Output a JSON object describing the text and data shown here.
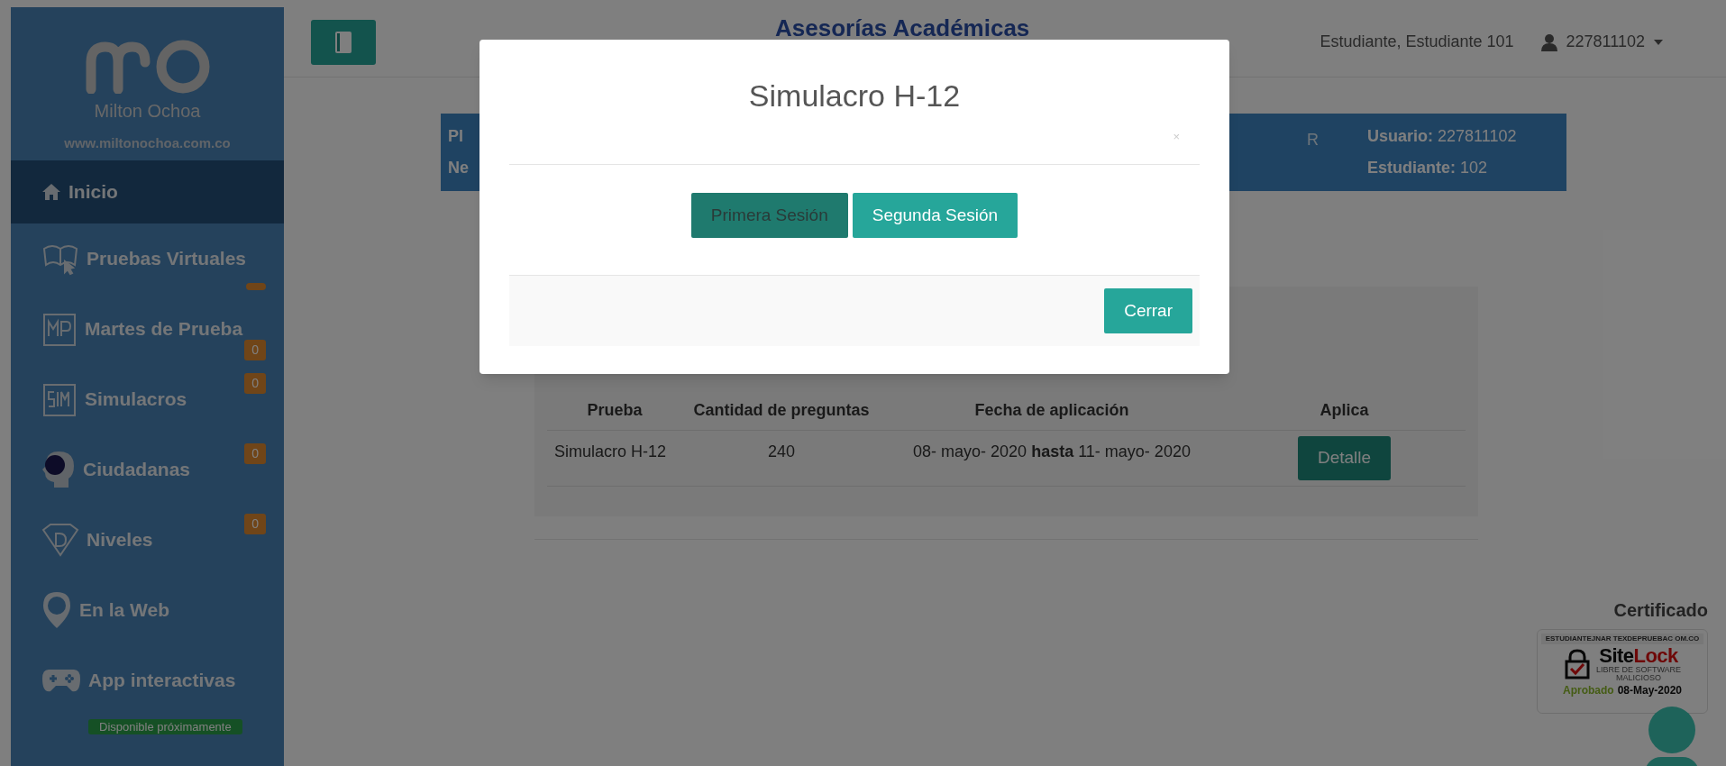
{
  "sidebar": {
    "brand": "Milton Ochoa",
    "website": "www.miltonochoa.com.co",
    "items": [
      {
        "label": "Inicio",
        "selected": true
      },
      {
        "label": "Pruebas Virtuales",
        "selected": false,
        "empty_badge": true
      },
      {
        "label": "Martes de Prueba",
        "selected": false,
        "badge": "0"
      },
      {
        "label": "Simulacros",
        "selected": false,
        "badge": "0"
      },
      {
        "label": "Ciudadanas",
        "selected": false,
        "badge": "0"
      },
      {
        "label": "Niveles",
        "selected": false,
        "badge": "0"
      },
      {
        "label": "En la Web",
        "selected": false
      },
      {
        "label": "App interactivas",
        "selected": false,
        "note": "Disponible próximamente"
      }
    ]
  },
  "header": {
    "title": "Asesorías Académicas",
    "user_name": "Estudiante, Estudiante 101",
    "user_id": "227811102"
  },
  "info_box": {
    "left": [
      "Pl",
      "Ne"
    ],
    "middle": "R",
    "right": [
      {
        "label": "Usuario:",
        "value": "227811102"
      },
      {
        "label": "Estudiante:",
        "value": "102"
      }
    ]
  },
  "table": {
    "columns": [
      "Prueba",
      "Cantidad de preguntas",
      "Fecha de aplicación",
      "Aplica"
    ],
    "rows": [
      {
        "prueba": "Simulacro H-12",
        "cantidad": "240",
        "fecha": "08- mayo- 2020 **hasta** 11- mayo- 2020",
        "action": "Detalle"
      }
    ]
  },
  "certificate": {
    "heading": "Certificado",
    "domain": "ESTUDIANTEJNAR TEXDEPRUEBAC OM.CO",
    "brand_a": "Site",
    "brand_b": "Lock",
    "line1": "LIBRE DE SOFTWARE",
    "line2": "MALICIOSO",
    "status": "Aprobado",
    "date": "08-May-2020"
  },
  "modal": {
    "title": "Simulacro H-12",
    "close": "×",
    "sessions": [
      {
        "label": "Primera Sesión",
        "selected": true
      },
      {
        "label": "Segunda Sesión",
        "selected": false
      }
    ],
    "footer_button": "Cerrar"
  }
}
